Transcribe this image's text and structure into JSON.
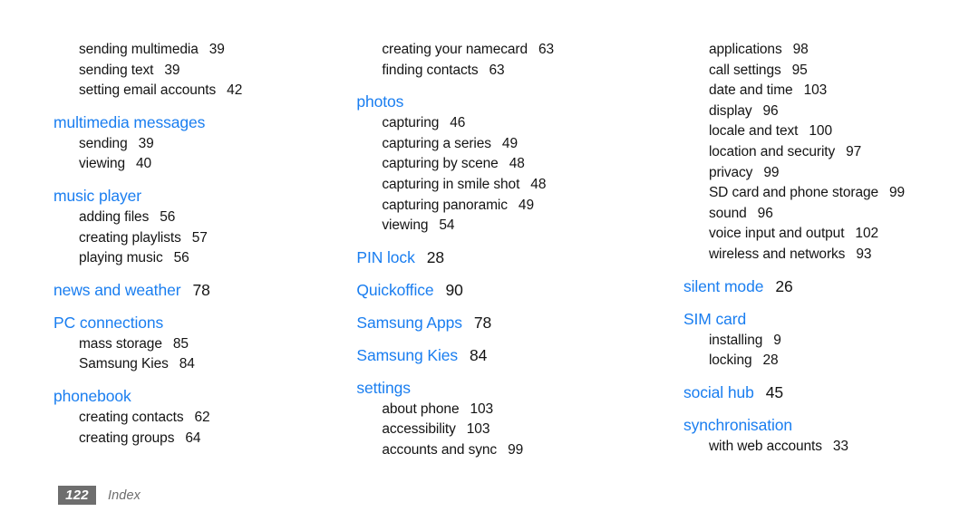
{
  "footer": {
    "page_number": "122",
    "section_label": "Index"
  },
  "colors": {
    "heading": "#1a7ef0",
    "body_text": "#141414",
    "footer_gray": "#6e6e6e",
    "background": "#ffffff"
  },
  "columns": [
    {
      "groups": [
        {
          "heading": null,
          "spaced": false,
          "entries": [
            {
              "label": "sending multimedia",
              "page": "39"
            },
            {
              "label": "sending text",
              "page": "39"
            },
            {
              "label": "setting email accounts",
              "page": "42"
            }
          ]
        },
        {
          "heading": {
            "label": "multimedia messages",
            "page": null
          },
          "spaced": true,
          "entries": [
            {
              "label": "sending",
              "page": "39"
            },
            {
              "label": "viewing",
              "page": "40"
            }
          ]
        },
        {
          "heading": {
            "label": "music player",
            "page": null
          },
          "spaced": true,
          "entries": [
            {
              "label": "adding files",
              "page": "56"
            },
            {
              "label": "creating playlists",
              "page": "57"
            },
            {
              "label": "playing music",
              "page": "56"
            }
          ]
        },
        {
          "heading": {
            "label": "news and weather",
            "page": "78"
          },
          "spaced": true,
          "entries": []
        },
        {
          "heading": {
            "label": "PC connections",
            "page": null
          },
          "spaced": true,
          "entries": [
            {
              "label": "mass storage",
              "page": "85"
            },
            {
              "label": "Samsung Kies",
              "page": "84"
            }
          ]
        },
        {
          "heading": {
            "label": "phonebook",
            "page": null
          },
          "spaced": true,
          "entries": [
            {
              "label": "creating contacts",
              "page": "62"
            },
            {
              "label": "creating groups",
              "page": "64"
            }
          ]
        }
      ]
    },
    {
      "groups": [
        {
          "heading": null,
          "spaced": false,
          "entries": [
            {
              "label": "creating your namecard",
              "page": "63"
            },
            {
              "label": "finding contacts",
              "page": "63"
            }
          ]
        },
        {
          "heading": {
            "label": "photos",
            "page": null
          },
          "spaced": true,
          "entries": [
            {
              "label": "capturing",
              "page": "46"
            },
            {
              "label": "capturing a series",
              "page": "49"
            },
            {
              "label": "capturing by scene",
              "page": "48"
            },
            {
              "label": "capturing in smile shot",
              "page": "48"
            },
            {
              "label": "capturing panoramic",
              "page": "49"
            },
            {
              "label": "viewing",
              "page": "54"
            }
          ]
        },
        {
          "heading": {
            "label": "PIN lock",
            "page": "28"
          },
          "spaced": true,
          "entries": []
        },
        {
          "heading": {
            "label": "Quickoffice",
            "page": "90"
          },
          "spaced": true,
          "entries": []
        },
        {
          "heading": {
            "label": "Samsung Apps",
            "page": "78"
          },
          "spaced": true,
          "entries": []
        },
        {
          "heading": {
            "label": "Samsung Kies",
            "page": "84"
          },
          "spaced": true,
          "entries": []
        },
        {
          "heading": {
            "label": "settings",
            "page": null
          },
          "spaced": true,
          "entries": [
            {
              "label": "about phone",
              "page": "103"
            },
            {
              "label": "accessibility",
              "page": "103"
            },
            {
              "label": "accounts and sync",
              "page": "99"
            }
          ]
        }
      ]
    },
    {
      "groups": [
        {
          "heading": null,
          "spaced": false,
          "entries": [
            {
              "label": "applications",
              "page": "98"
            },
            {
              "label": "call settings",
              "page": "95"
            },
            {
              "label": "date and time",
              "page": "103"
            },
            {
              "label": "display",
              "page": "96"
            },
            {
              "label": "locale and text",
              "page": "100"
            },
            {
              "label": "location and security",
              "page": "97"
            },
            {
              "label": "privacy",
              "page": "99"
            },
            {
              "label": "SD card and phone storage",
              "page": "99"
            },
            {
              "label": "sound",
              "page": "96"
            },
            {
              "label": "voice input and output",
              "page": "102"
            },
            {
              "label": "wireless and networks",
              "page": "93"
            }
          ]
        },
        {
          "heading": {
            "label": "silent mode",
            "page": "26"
          },
          "spaced": true,
          "entries": []
        },
        {
          "heading": {
            "label": "SIM card",
            "page": null
          },
          "spaced": true,
          "entries": [
            {
              "label": "installing",
              "page": "9"
            },
            {
              "label": "locking",
              "page": "28"
            }
          ]
        },
        {
          "heading": {
            "label": "social hub",
            "page": "45"
          },
          "spaced": true,
          "entries": []
        },
        {
          "heading": {
            "label": "synchronisation",
            "page": null
          },
          "spaced": true,
          "entries": [
            {
              "label": "with web accounts",
              "page": "33"
            }
          ]
        }
      ]
    }
  ]
}
